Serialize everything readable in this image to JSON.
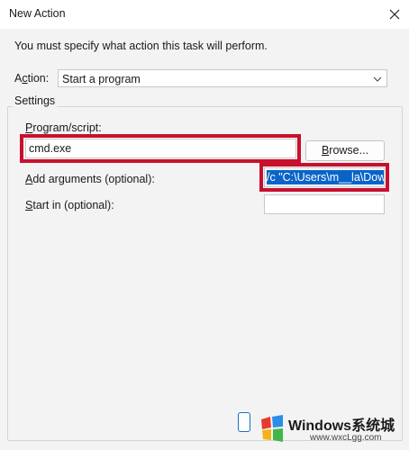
{
  "window": {
    "title": "New Action"
  },
  "dialog": {
    "prompt": "You must specify what action this task will perform.",
    "action_label": "Action:",
    "action_value": "Start a program",
    "settings_caption": "Settings",
    "program_label": "Program/script:",
    "program_value": "cmd.exe",
    "browse_label": "Browse...",
    "arguments_label": "Add arguments (optional):",
    "arguments_value": "/c \"C:\\Users\\m__la\\Dow",
    "startin_label": "Start in (optional):",
    "startin_value": ""
  },
  "highlight_color": "#c8102e",
  "selection_color": "#0a64c8",
  "watermark": {
    "title": "Windows系统城",
    "url": "www.wxcLgg.com"
  },
  "icons": [
    "close-icon",
    "chevron-down-icon",
    "windows-logo-icon"
  ]
}
